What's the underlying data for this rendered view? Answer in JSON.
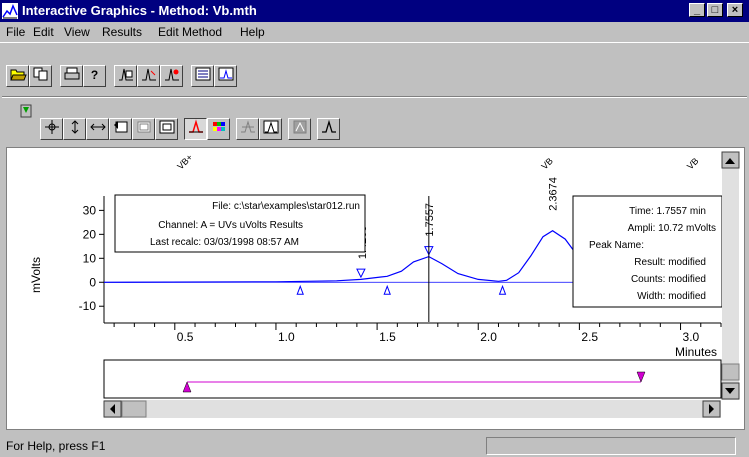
{
  "window": {
    "title": "Interactive Graphics - Method: Vb.mth",
    "minimize": "_",
    "maximize": "□",
    "close": "×"
  },
  "menu": {
    "file": "File",
    "edit": "Edit",
    "view": "View",
    "results": "Results",
    "edit_method": "Edit Method",
    "help": "Help"
  },
  "chart_data": {
    "type": "line",
    "title": "",
    "xlabel": "Minutes",
    "ylabel": "mVolts",
    "xlim": [
      0.15,
      3.2
    ],
    "ylim": [
      -17,
      36
    ],
    "x_ticks": [
      "0.5",
      "1.0",
      "1.5",
      "2.0",
      "2.5",
      "3.0"
    ],
    "y_ticks": [
      "30",
      "20",
      "10",
      "0",
      "-10"
    ],
    "series": [
      {
        "points": [
          [
            0.15,
            0
          ],
          [
            1.0,
            0.2
          ],
          [
            1.3,
            0.6
          ],
          [
            1.42,
            1.2
          ],
          [
            1.55,
            2.5
          ],
          [
            1.62,
            4.6
          ],
          [
            1.68,
            8.5
          ],
          [
            1.7557,
            10.72
          ],
          [
            1.82,
            7.8
          ],
          [
            1.9,
            3.6
          ],
          [
            2.0,
            1.2
          ],
          [
            2.1,
            0.4
          ],
          [
            2.14,
            0.8
          ],
          [
            2.2,
            4
          ],
          [
            2.26,
            11
          ],
          [
            2.32,
            19
          ],
          [
            2.3674,
            21.5
          ],
          [
            2.43,
            18
          ],
          [
            2.5,
            10
          ],
          [
            2.58,
            4
          ],
          [
            2.68,
            1.2
          ],
          [
            2.8,
            0.5
          ],
          [
            3.0,
            0.3
          ],
          [
            3.2,
            0.2
          ]
        ]
      }
    ],
    "peak_labels": [
      {
        "time": "1.4265",
        "x": 1.4265,
        "y": 1.3
      },
      {
        "time": "1.7557",
        "x": 1.7557,
        "y": 10.72
      },
      {
        "time": "2.3674",
        "x": 2.3674,
        "y": 21.5
      }
    ],
    "start_markers": [
      1.12,
      1.55,
      2.12
    ],
    "end_markers": [
      1.42,
      1.7557
    ],
    "vb_labels": [
      {
        "text": "VB+",
        "x": 0.53
      },
      {
        "text": "VB",
        "x": 2.33
      },
      {
        "text": "VB",
        "x": 3.05
      }
    ],
    "cursor_x": 1.7557
  },
  "file_box": {
    "file": "File: c:\\star\\examples\\star012.run",
    "channel": "Channel: A = UVs uVolts Results",
    "recalc": "Last recalc: 03/03/1998 08:57 AM"
  },
  "peak_box": {
    "time": "Time: 1.7557 min",
    "ampli": "Ampli: 10.72 mVolts",
    "peak_name": "Peak Name:",
    "result": "Result: modified",
    "counts": "Counts: modified",
    "width": "Width: modified"
  },
  "status": {
    "text": "For Help, press F1"
  },
  "colors": {
    "titlebar": "#000080",
    "trace": "#0000ff",
    "marker_line": "#d000d0"
  }
}
